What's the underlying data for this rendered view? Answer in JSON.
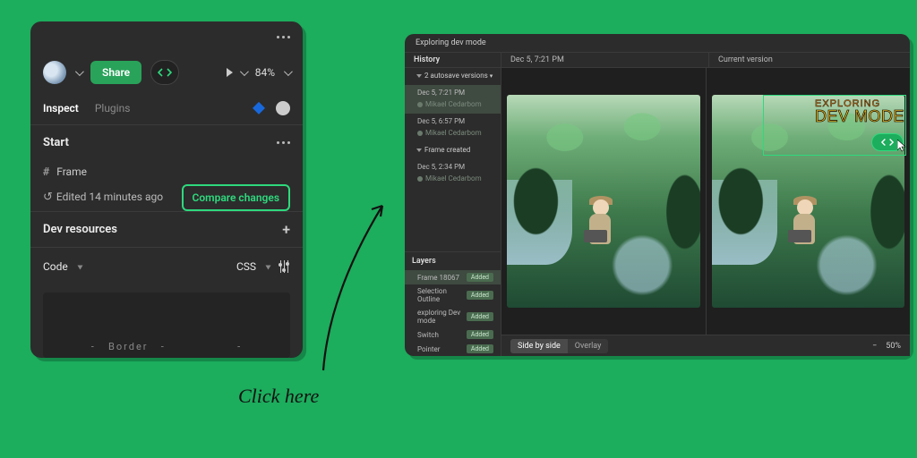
{
  "annotation": {
    "text": "Click here"
  },
  "inspect": {
    "toolbar": {
      "share_label": "Share",
      "zoom": "84%"
    },
    "tabs": {
      "inspect": "Inspect",
      "plugins": "Plugins"
    },
    "start": {
      "heading": "Start",
      "frame_label": "Frame",
      "edited_label": "Edited 14 minutes ago",
      "compare_label": "Compare changes"
    },
    "dev_resources": {
      "heading": "Dev resources"
    },
    "code": {
      "heading": "Code",
      "lang": "CSS",
      "border_label": "Border"
    }
  },
  "history_window": {
    "title": "Exploring dev mode",
    "columns": {
      "history": "History",
      "timestamp": "Dec 5, 7:21 PM",
      "current": "Current version"
    },
    "autosave_group": "2 autosave versions",
    "entries": [
      {
        "time": "Dec 5, 7:21 PM",
        "author": "Mikael Cedarbom",
        "selected": true
      },
      {
        "time": "Dec 5, 6:57 PM",
        "author": "Mikael Cedarbom",
        "selected": false
      }
    ],
    "frame_created": {
      "label": "Frame created",
      "time": "Dec 5, 2:34 PM",
      "author": "Mikael Cedarbom"
    },
    "layers_heading": "Layers",
    "layers": [
      {
        "name": "Frame 18067",
        "badge": "Added",
        "selected": true
      },
      {
        "name": "Selection Outline",
        "badge": "Added",
        "selected": false
      },
      {
        "name": "exploring Dev mode",
        "badge": "Added",
        "selected": false
      },
      {
        "name": "Switch",
        "badge": "Added",
        "selected": false
      },
      {
        "name": "Pointer",
        "badge": "Added",
        "selected": false
      }
    ],
    "artwork": {
      "line1": "EXPLORING",
      "line2": "DEV MODE"
    },
    "status": {
      "side_by_side": "Side by side",
      "overlay": "Overlay",
      "zoom": "50%"
    }
  }
}
